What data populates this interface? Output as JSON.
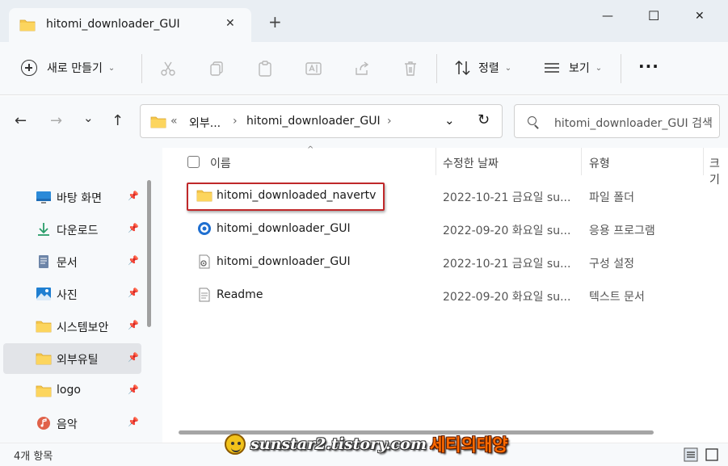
{
  "window": {
    "tab_title": "hitomi_downloader_GUI",
    "close_tab_glyph": "✕",
    "new_tab_glyph": "+",
    "minimize_glyph": "—",
    "maximize_glyph": "☐",
    "close_glyph": "✕"
  },
  "toolbar": {
    "new_label": "새로 만들기",
    "caret": "⌄",
    "sort_label": "정렬",
    "view_label": "보기",
    "more_label": "···"
  },
  "nav": {
    "back_glyph": "←",
    "forward_glyph": "→",
    "recent_glyph": "⌄",
    "up_glyph": "↑",
    "breadcrumb": {
      "overflow": "«",
      "parent": "외부...",
      "sep": "›",
      "current": "hitomi_downloader_GUI"
    },
    "dropdown_glyph": "⌄",
    "refresh_glyph": "↻"
  },
  "search": {
    "placeholder": "hitomi_downloader_GUI 검색"
  },
  "sidebar": {
    "pin_glyph": "📌",
    "items": [
      {
        "label": "바탕 화면",
        "icon": "desktop-icon"
      },
      {
        "label": "다운로드",
        "icon": "download-icon"
      },
      {
        "label": "문서",
        "icon": "document-icon"
      },
      {
        "label": "사진",
        "icon": "pictures-icon"
      },
      {
        "label": "시스템보안",
        "icon": "folder-icon"
      },
      {
        "label": "외부유틸",
        "icon": "folder-icon"
      },
      {
        "label": "logo",
        "icon": "folder-icon"
      },
      {
        "label": "음악",
        "icon": "music-icon"
      }
    ]
  },
  "columns": {
    "name": "이름",
    "date": "수정한 날짜",
    "type": "유형",
    "size": "크기",
    "sort_glyph": "^"
  },
  "files": [
    {
      "name": "hitomi_downloaded_navertv",
      "date": "2022-10-21 금요일 su...",
      "type": "파일 폴더",
      "icon": "folder-icon"
    },
    {
      "name": "hitomi_downloader_GUI",
      "date": "2022-09-20 화요일 su...",
      "type": "응용 프로그램",
      "icon": "application-icon"
    },
    {
      "name": "hitomi_downloader_GUI",
      "date": "2022-10-21 금요일 su...",
      "type": "구성 설정",
      "icon": "config-file-icon"
    },
    {
      "name": "Readme",
      "date": "2022-09-20 화요일 su...",
      "type": "텍스트 문서",
      "icon": "text-file-icon"
    }
  ],
  "status": {
    "item_count": "4개 항목"
  },
  "watermark": {
    "url": "sunstar2.tistory.com",
    "name": "세티의태양"
  },
  "colors": {
    "accent": "#0067c0",
    "folder": "#f6c84c",
    "highlight_border": "#c0282a"
  }
}
